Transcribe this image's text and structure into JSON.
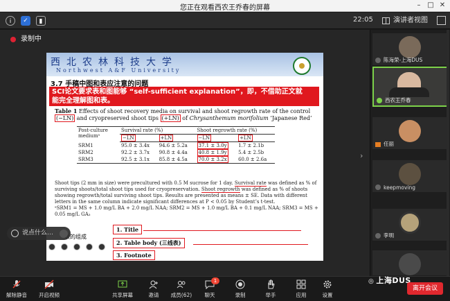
{
  "topbar": {
    "watching": "您正在观看西农王乔春的屏幕"
  },
  "toolbar": {
    "clock": "22:05",
    "view_label": "演讲者视图"
  },
  "recording": {
    "label": "录制中"
  },
  "slide": {
    "school_cn": "西北农林科技大学",
    "school_en": "Northwest A&F University",
    "heading": "3.7 手稿中图和表应注意的问题",
    "banner_line1": "SCI论文要求表和图能够 “self-sufficient explanation”，即，不借助正文就",
    "banner_line2": "能完全理解图和表。",
    "caption_lead": "Table 1",
    "caption_a": " Effects of shoot recovery media on survival and shoot regrowth rate of the control ",
    "caption_ln_minus": "(−LN)",
    "caption_b": " and cryopreserved shoot tips ",
    "caption_ln_plus": "(+LN)",
    "caption_c": " of ",
    "caption_species": "Chrysanthemum morifolium",
    "caption_d": " ‘Japanese Red’",
    "table": {
      "col_medium": "Post-culture mediumᵃ",
      "col_survival": "Survival rate (%)",
      "col_regrowth": "Shoot regrowth rate (%)",
      "sub_minus": "−LN",
      "sub_plus": "+LN",
      "rows": [
        {
          "medium": "SRM1",
          "s_minus": "95.0 ± 3.4x",
          "s_plus": "94.6 ± 5.2a",
          "r_minus": "37.1 ± 3.0y",
          "r_plus": "1.7 ± 2.1b"
        },
        {
          "medium": "SRM2",
          "s_minus": "92.2 ± 3.7x",
          "s_plus": "90.8 ± 4.4a",
          "r_minus": "40.8 ± 1.9y",
          "r_plus": "5.4 ± 2.5b"
        },
        {
          "medium": "SRM3",
          "s_minus": "92.5 ± 3.1x",
          "s_plus": "85.8 ± 4.5a",
          "r_minus": "70.0 ± 3.2x",
          "r_plus": "60.0 ± 2.6a"
        }
      ]
    },
    "notes_1a": "Shoot tips (2 mm in size) were precultured with 0.5 M sucrose for 1 day. ",
    "notes_1b": "Survival rate",
    "notes_1c": " was defined as % of surviving shoots/total shoot tips used for cryopreservation. ",
    "notes_1d": "Shoot regrowth",
    "notes_1e": " was defined as % of shoots showing regrowth/total surviving shoot tips. Results are presented as means ± SE. Data with different letters in the same column indicate significant differences at P < 0.05 by Student’s t-test.",
    "notes_2": "ᵃSRM1 = MS + 1.0 mg/L BA + 2.0 mg/L NAA; SRM2 = MS + 1.0 mg/L BA + 0.1 mg/L NAA; SRM3 = MS + 0.05 mg/L GA₃",
    "label_title": "1. Title",
    "label_body": "2. Table body (三线表)",
    "label_footnote": "3. Footnote",
    "side_note": "表的组成"
  },
  "chat_hint": "说点什么…",
  "participants": [
    {
      "name": "陈海荣-上海DUS"
    },
    {
      "name": "西农王乔春"
    },
    {
      "name": "任丽"
    },
    {
      "name": "keepmoving"
    },
    {
      "name": "李明"
    },
    {
      "name": ""
    }
  ],
  "bottom": {
    "mute": "解除静音",
    "video": "开启视频",
    "share": "共享屏幕",
    "invite": "邀请",
    "members": "成员(62)",
    "chat": "聊天",
    "chat_badge": "1",
    "record": "录制",
    "hand": "举手",
    "apps": "应用",
    "settings": "设置",
    "leave": "离开会议"
  },
  "watermark": "上海DUS",
  "colors": {
    "accent_red": "#e0181e",
    "speaking_green": "#7dd34a",
    "leave_red": "#e0282e"
  }
}
